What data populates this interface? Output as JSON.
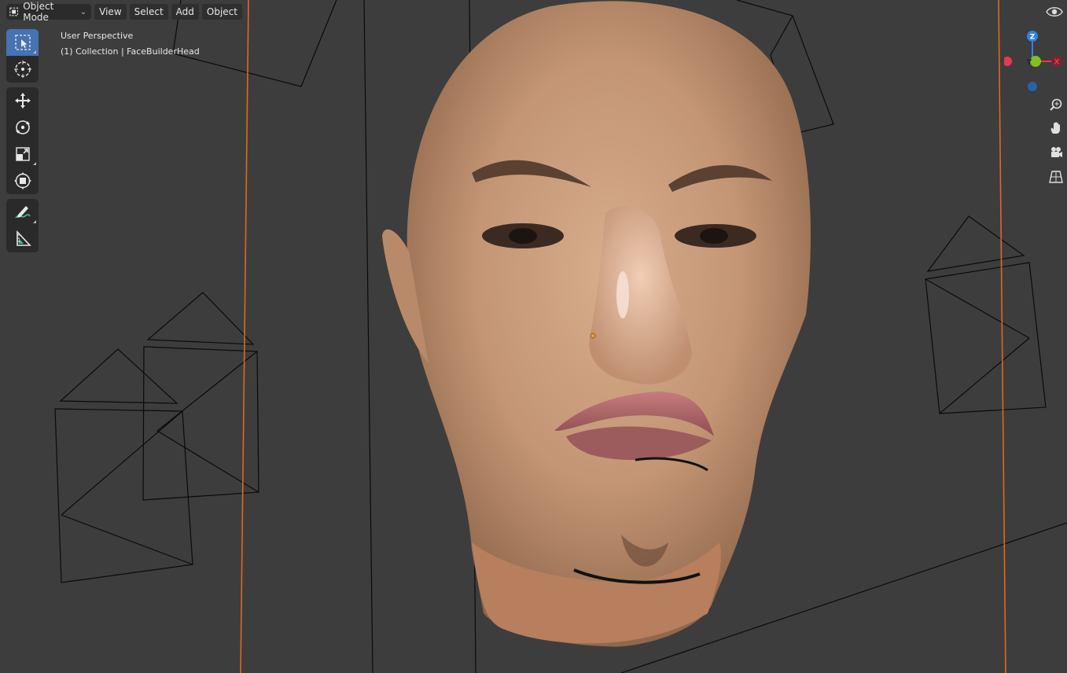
{
  "header": {
    "mode_label": "Object Mode",
    "menus": [
      "View",
      "Select",
      "Add",
      "Object"
    ]
  },
  "overlay": {
    "perspective": "User Perspective",
    "collection": "(1) Collection | FaceBuilderHead"
  },
  "gizmo": {
    "z_label": "Z",
    "y_label": "Y",
    "x_label": "X"
  },
  "toolbar": {
    "tools": [
      "select-box",
      "cursor",
      "move",
      "rotate",
      "scale",
      "transform",
      "annotate",
      "measure"
    ],
    "active": "select-box"
  },
  "colors": {
    "viewport_bg": "#3d3d3d",
    "active_tool": "#4772b3",
    "orange_line": "#e0681c",
    "axis_x": "#e8384f",
    "axis_y": "#7fc120",
    "axis_z": "#2f83e3"
  }
}
